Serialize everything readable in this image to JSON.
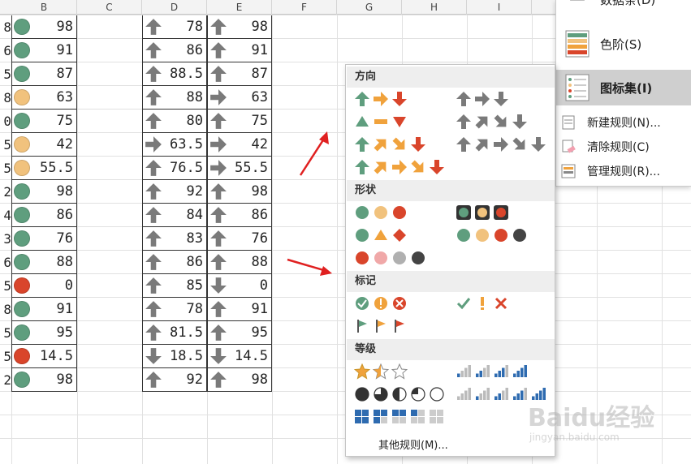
{
  "columns": [
    "B",
    "C",
    "D",
    "E",
    "F",
    "G",
    "H",
    "I"
  ],
  "row_edge_labels": [
    "8",
    "6",
    "5",
    "8",
    "0",
    "5",
    "5",
    "2",
    "4",
    "3",
    "6",
    "5",
    "8",
    "5",
    "5",
    "2"
  ],
  "col_b": [
    {
      "v": "98",
      "c": "green"
    },
    {
      "v": "91",
      "c": "green"
    },
    {
      "v": "87",
      "c": "green"
    },
    {
      "v": "63",
      "c": "yellow"
    },
    {
      "v": "75",
      "c": "green"
    },
    {
      "v": "42",
      "c": "yellow"
    },
    {
      "v": "55.5",
      "c": "yellow"
    },
    {
      "v": "98",
      "c": "green"
    },
    {
      "v": "86",
      "c": "green"
    },
    {
      "v": "76",
      "c": "green"
    },
    {
      "v": "88",
      "c": "green"
    },
    {
      "v": "0",
      "c": "red"
    },
    {
      "v": "91",
      "c": "green"
    },
    {
      "v": "95",
      "c": "green"
    },
    {
      "v": "14.5",
      "c": "red"
    },
    {
      "v": "98",
      "c": "green"
    }
  ],
  "col_d": [
    {
      "v": "78",
      "a": "up"
    },
    {
      "v": "86",
      "a": "up"
    },
    {
      "v": "88.5",
      "a": "up"
    },
    {
      "v": "88",
      "a": "up"
    },
    {
      "v": "80",
      "a": "up"
    },
    {
      "v": "63.5",
      "a": "right"
    },
    {
      "v": "76.5",
      "a": "up"
    },
    {
      "v": "92",
      "a": "up"
    },
    {
      "v": "84",
      "a": "up"
    },
    {
      "v": "83",
      "a": "up"
    },
    {
      "v": "86",
      "a": "up"
    },
    {
      "v": "85",
      "a": "up"
    },
    {
      "v": "78",
      "a": "up"
    },
    {
      "v": "81.5",
      "a": "up"
    },
    {
      "v": "18.5",
      "a": "down"
    },
    {
      "v": "92",
      "a": "up"
    }
  ],
  "col_e": [
    {
      "v": "98",
      "a": "up"
    },
    {
      "v": "91",
      "a": "up"
    },
    {
      "v": "87",
      "a": "up"
    },
    {
      "v": "63",
      "a": "right"
    },
    {
      "v": "75",
      "a": "up"
    },
    {
      "v": "42",
      "a": "right"
    },
    {
      "v": "55.5",
      "a": "right"
    },
    {
      "v": "98",
      "a": "up"
    },
    {
      "v": "86",
      "a": "up"
    },
    {
      "v": "76",
      "a": "up"
    },
    {
      "v": "88",
      "a": "up"
    },
    {
      "v": "0",
      "a": "down"
    },
    {
      "v": "91",
      "a": "up"
    },
    {
      "v": "95",
      "a": "up"
    },
    {
      "v": "14.5",
      "a": "down"
    },
    {
      "v": "98",
      "a": "up"
    }
  ],
  "ribbon": {
    "top_item": "数据条(D)",
    "color_scale": "色阶(S)",
    "icon_sets": "图标集(I)",
    "new_rule": "新建规则(N)...",
    "clear_rules": "清除规则(C)",
    "manage_rules": "管理规则(R)..."
  },
  "popup": {
    "sections": [
      "方向",
      "形状",
      "标记",
      "等级"
    ],
    "other_rules": "其他规则(M)..."
  },
  "watermark": {
    "main": "Baidu经验",
    "sub": "jingyan.baidu.com"
  },
  "colors": {
    "green": "#5f9e7e",
    "yellow": "#f1c27d",
    "red": "#d9452b",
    "orange": "#f0a23c",
    "gray": "#7a7a7a",
    "blue": "#2e6bb0"
  }
}
